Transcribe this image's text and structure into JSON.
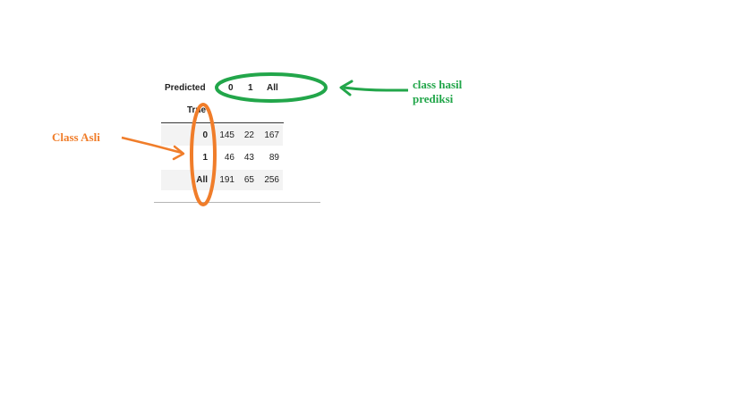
{
  "table": {
    "corner_label": "Predicted",
    "index_name": "True",
    "columns": [
      "0",
      "1",
      "All"
    ],
    "rows": [
      {
        "label": "0",
        "values": [
          "145",
          "22",
          "167"
        ]
      },
      {
        "label": "1",
        "values": [
          "46",
          "43",
          "89"
        ]
      },
      {
        "label": "All",
        "values": [
          "191",
          "65",
          "256"
        ]
      }
    ]
  },
  "annotations": {
    "predicted_class": {
      "line1": "class hasil",
      "line2": "prediksi",
      "color": "#22a64a"
    },
    "true_class": {
      "text": "Class Asli",
      "color": "#f07d2a"
    }
  }
}
